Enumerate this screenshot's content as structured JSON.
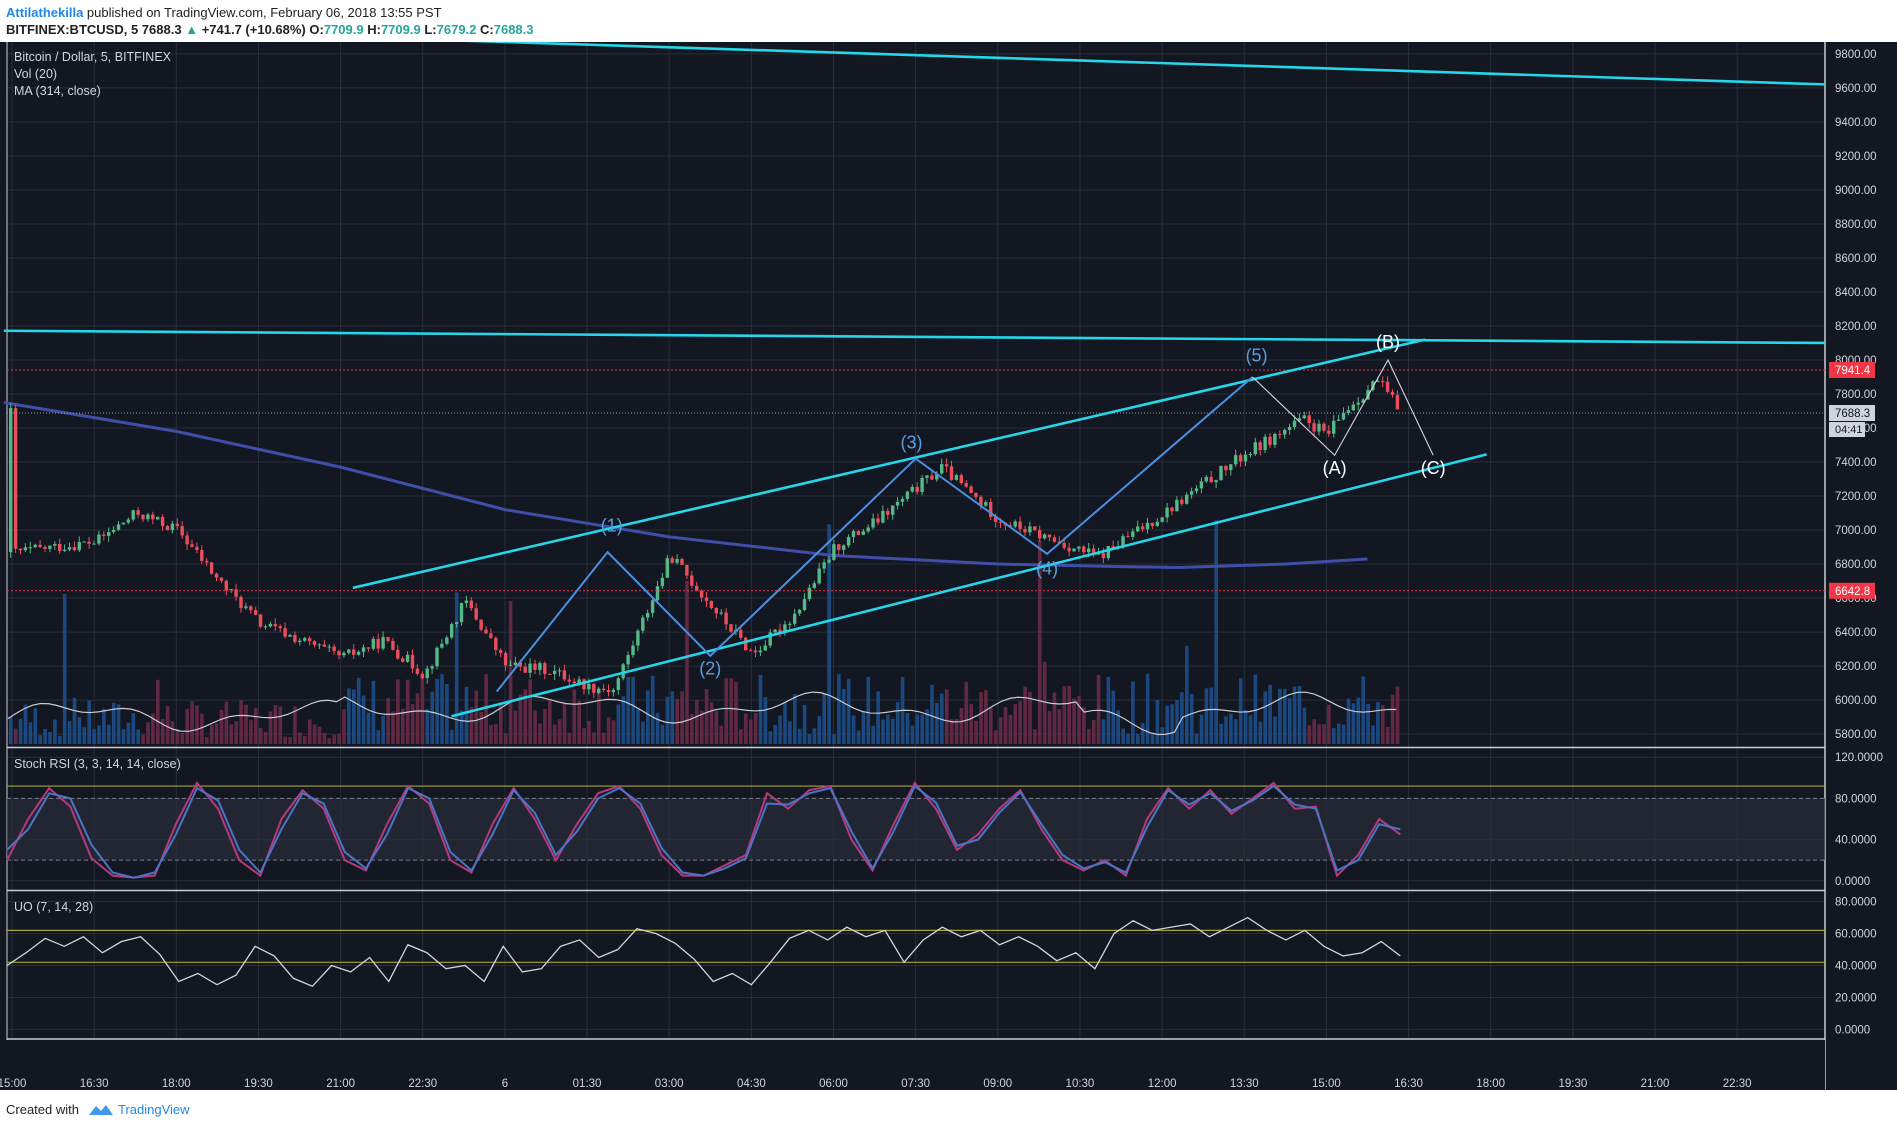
{
  "header": {
    "author": "Attilathekilla",
    "published": "published on TradingView.com, February 06, 2018 13:55 PST",
    "symbol": "BITFINEX:BTCUSD, 5",
    "last": "7688.3",
    "change_arrow": "▲",
    "change": "+741.7 (+10.68%)",
    "o_label": "O:",
    "o_value": "7709.9",
    "h_label": "H:",
    "h_value": "7709.9",
    "l_label": "L:",
    "l_value": "7679.2",
    "c_label": "C:",
    "c_value": "7688.3"
  },
  "legend": {
    "main": "Bitcoin / Dollar, 5, BITFINEX",
    "vol": "Vol (20)",
    "ma": "MA (314, close)",
    "stoch": "Stoch RSI (3, 3, 14, 14, close)",
    "uo": "UO (7, 14, 28)"
  },
  "colors": {
    "background": "#131722",
    "grid": "#2a2e39",
    "trendline": "#24d7e9",
    "wave": "#4a90e2",
    "ma": "#3f4fa8",
    "up": "#53b987",
    "down": "#eb4d5c",
    "level": "#f23645",
    "band": "#a6a62e"
  },
  "footer": {
    "created": "Created with",
    "brand": "TradingView"
  },
  "chart_data": [
    {
      "type": "candlestick",
      "title": "Bitcoin / Dollar, 5, BITFINEX",
      "x_ticks": [
        "15:00",
        "16:30",
        "18:00",
        "19:30",
        "21:00",
        "22:30",
        "6",
        "01:30",
        "03:00",
        "04:30",
        "06:00",
        "07:30",
        "09:00",
        "10:30",
        "12:00",
        "13:30",
        "15:00",
        "16:30",
        "18:00",
        "19:30",
        "21:00",
        "22:30"
      ],
      "y_ticks": [
        5800,
        6000,
        6200,
        6400,
        6600,
        6800,
        7000,
        7200,
        7400,
        7600,
        7800,
        8000,
        8200,
        8400,
        8600,
        8800,
        9000,
        9200,
        9400,
        9600,
        9800
      ],
      "ylim": [
        5730,
        9870
      ],
      "price_path": [
        [
          0,
          6870
        ],
        [
          1,
          6930
        ],
        [
          1.5,
          7100
        ],
        [
          2,
          7000
        ],
        [
          2.5,
          6700
        ],
        [
          3,
          6450
        ],
        [
          3.5,
          6350
        ],
        [
          4,
          6250
        ],
        [
          4.5,
          6350
        ],
        [
          5,
          6150
        ],
        [
          5.5,
          6580
        ],
        [
          6,
          6200
        ],
        [
          6.5,
          6180
        ],
        [
          7,
          6080
        ],
        [
          7.3,
          6060
        ],
        [
          8,
          6850
        ],
        [
          8.5,
          6550
        ],
        [
          9,
          6270
        ],
        [
          9.5,
          6500
        ],
        [
          10,
          6900
        ],
        [
          10.5,
          7050
        ],
        [
          11.3,
          7370
        ],
        [
          12,
          7060
        ],
        [
          13.2,
          6840
        ],
        [
          14,
          7100
        ],
        [
          15,
          7450
        ],
        [
          15.7,
          7650
        ],
        [
          16,
          7560
        ],
        [
          16.2,
          7700
        ],
        [
          16.6,
          7880
        ],
        [
          16.9,
          7690
        ]
      ],
      "last_price": "7688.3",
      "countdown": "04:41",
      "levels": [
        {
          "value": 7941.4,
          "label": "7941.4"
        },
        {
          "value": 6642.8,
          "label": "6642.8"
        }
      ],
      "trendlines": [
        {
          "x1": -0.1,
          "y1": 9965,
          "x2": 22.1,
          "y2": 9620
        },
        {
          "x1": -0.1,
          "y1": 8172,
          "x2": 22.1,
          "y2": 8100
        },
        {
          "x1": 4.15,
          "y1": 6660,
          "x2": 17.2,
          "y2": 8120
        },
        {
          "x1": 5.35,
          "y1": 5905,
          "x2": 17.95,
          "y2": 7445
        }
      ],
      "ma_path": [
        [
          -0.1,
          7750
        ],
        [
          2,
          7580
        ],
        [
          4,
          7370
        ],
        [
          6,
          7120
        ],
        [
          8,
          6960
        ],
        [
          10,
          6850
        ],
        [
          12,
          6800
        ],
        [
          13.5,
          6785
        ],
        [
          14.2,
          6780
        ],
        [
          15.5,
          6800
        ],
        [
          16.5,
          6830
        ]
      ],
      "wave_path": [
        [
          5.9,
          6050
        ],
        [
          7.25,
          6870
        ],
        [
          8.5,
          6260
        ],
        [
          11,
          7420
        ],
        [
          12.6,
          6860
        ],
        [
          15.1,
          7900
        ]
      ],
      "abc_path": [
        [
          15.1,
          7900
        ],
        [
          16.1,
          7440
        ],
        [
          16.75,
          8000
        ],
        [
          17.3,
          7440
        ]
      ],
      "wave_labels": [
        {
          "text": "(1)",
          "x": 7.3,
          "y": 6990,
          "color": "#5b9ddb"
        },
        {
          "text": "(2)",
          "x": 8.5,
          "y": 6150,
          "color": "#5b9ddb"
        },
        {
          "text": "(3)",
          "x": 10.95,
          "y": 7480,
          "color": "#5b9ddb"
        },
        {
          "text": "(4)",
          "x": 12.6,
          "y": 6740,
          "color": "#5b9ddb"
        },
        {
          "text": "(5)",
          "x": 15.15,
          "y": 7990,
          "color": "#5b9ddb"
        },
        {
          "text": "(A)",
          "x": 16.1,
          "y": 7330,
          "color": "#ffffff"
        },
        {
          "text": "(B)",
          "x": 16.75,
          "y": 8070,
          "color": "#ffffff"
        },
        {
          "text": "(C)",
          "x": 17.3,
          "y": 7330,
          "color": "#ffffff"
        }
      ]
    },
    {
      "type": "line",
      "title": "Stoch RSI (3, 3, 14, 14, close)",
      "y_ticks": [
        0,
        40,
        80,
        120
      ],
      "y_tick_labels": [
        "0.0000",
        "40.0000",
        "80.0000",
        "120.0000"
      ],
      "ylim": [
        -8,
        128
      ],
      "bands": [
        80,
        20
      ],
      "band_fill": [
        20,
        80
      ],
      "upper_line": 92,
      "series": [
        {
          "color": "#b43a7c",
          "values": [
            20,
            60,
            90,
            72,
            22,
            5,
            3,
            5,
            55,
            95,
            70,
            20,
            5,
            60,
            88,
            70,
            20,
            10,
            55,
            92,
            75,
            20,
            8,
            55,
            90,
            60,
            20,
            55,
            85,
            92,
            70,
            25,
            5,
            5,
            15,
            25,
            85,
            70,
            88,
            92,
            40,
            10,
            55,
            95,
            70,
            30,
            45,
            70,
            88,
            50,
            20,
            10,
            20,
            5,
            60,
            90,
            70,
            88,
            65,
            80,
            95,
            70,
            72,
            5,
            25,
            60,
            45
          ]
        },
        {
          "color": "#4b74c6",
          "values": [
            30,
            50,
            85,
            80,
            35,
            8,
            3,
            8,
            45,
            90,
            78,
            30,
            8,
            50,
            85,
            75,
            28,
            12,
            45,
            90,
            80,
            28,
            10,
            45,
            88,
            66,
            25,
            48,
            80,
            90,
            75,
            32,
            8,
            5,
            12,
            22,
            75,
            74,
            85,
            90,
            48,
            12,
            48,
            92,
            76,
            34,
            40,
            66,
            86,
            55,
            25,
            12,
            18,
            8,
            52,
            88,
            74,
            85,
            68,
            78,
            92,
            74,
            70,
            10,
            20,
            55,
            50
          ]
        }
      ]
    },
    {
      "type": "line",
      "title": "UO (7, 14, 28)",
      "y_ticks": [
        0,
        20,
        40,
        60,
        80
      ],
      "y_tick_labels": [
        "0.0000",
        "20.0000",
        "40.0000",
        "60.0000",
        "80.0000"
      ],
      "ylim": [
        -6,
        86
      ],
      "bands": [
        62,
        42
      ],
      "series": [
        {
          "color": "#d1d4dc",
          "values": [
            40,
            48,
            57,
            52,
            58,
            48,
            55,
            58,
            47,
            30,
            35,
            28,
            34,
            52,
            46,
            32,
            27,
            40,
            36,
            45,
            30,
            53,
            48,
            38,
            40,
            30,
            52,
            36,
            38,
            52,
            56,
            45,
            50,
            63,
            60,
            54,
            44,
            30,
            35,
            28,
            42,
            57,
            62,
            56,
            64,
            58,
            62,
            42,
            56,
            64,
            58,
            62,
            53,
            58,
            52,
            43,
            48,
            38,
            60,
            68,
            62,
            64,
            66,
            58,
            64,
            70,
            62,
            56,
            62,
            52,
            46,
            48,
            55,
            46
          ]
        }
      ]
    }
  ]
}
